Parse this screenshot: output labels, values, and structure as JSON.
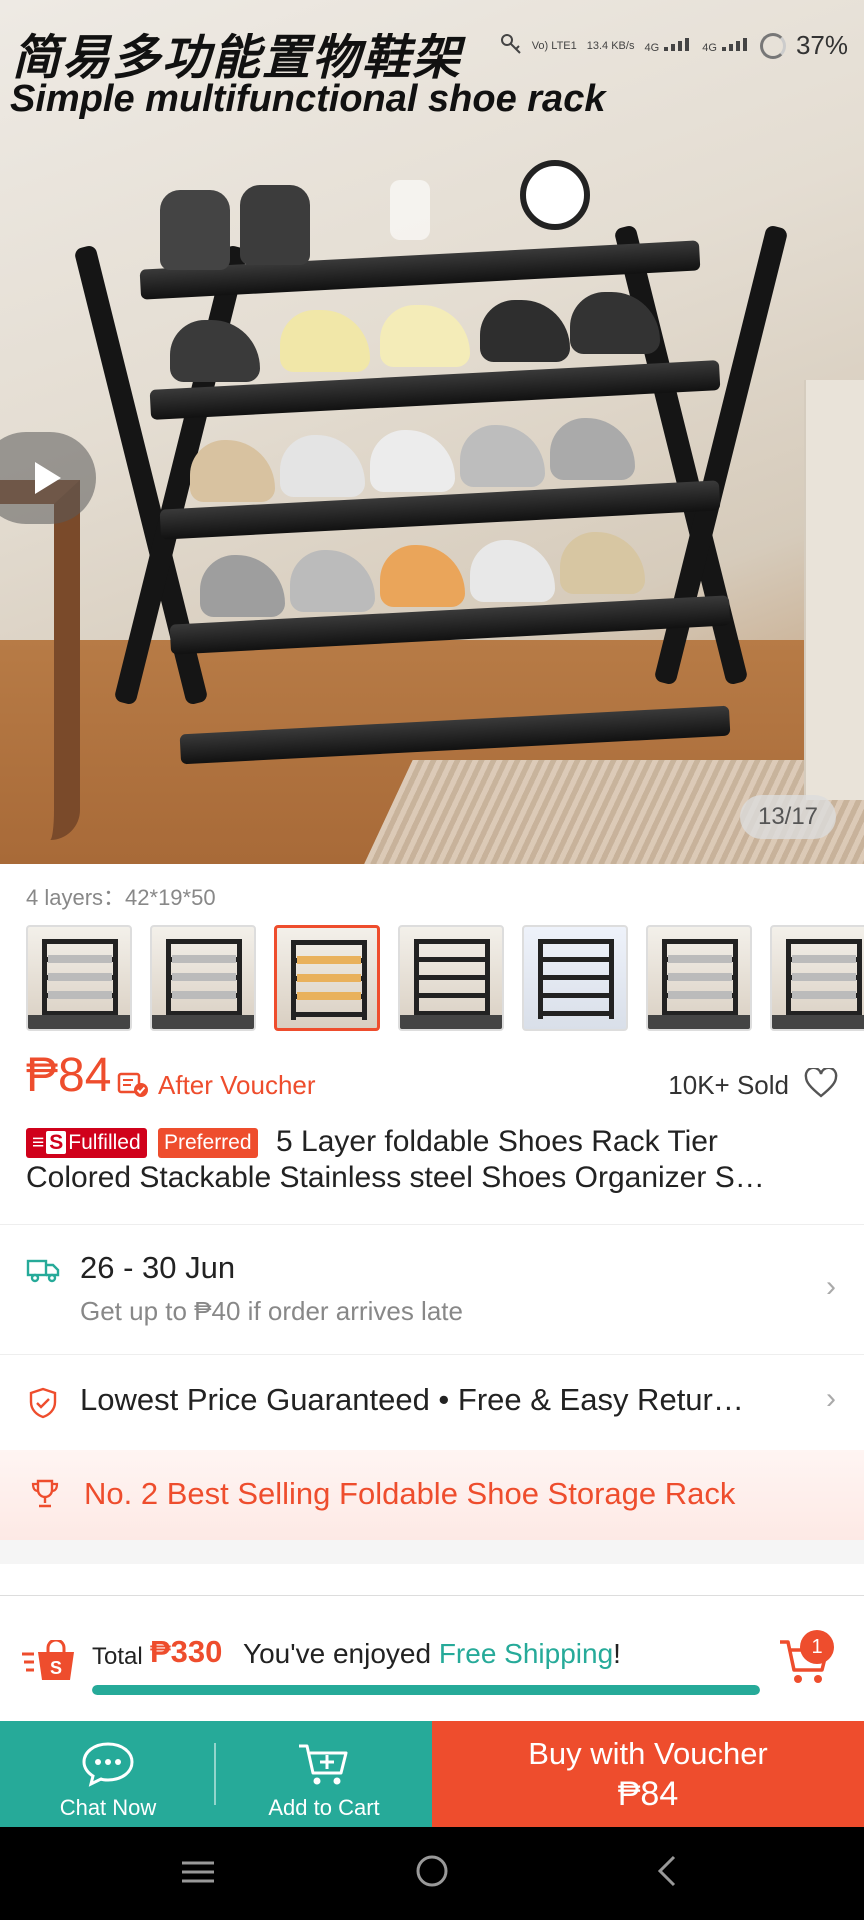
{
  "hero": {
    "title_cn": "简易多功能置物鞋架",
    "title_en": "Simple multifunctional shoe rack",
    "image_counter": "13/17"
  },
  "statusbar": {
    "volte": "Vo) LTE1",
    "speed": "13.4 KB/s",
    "net1": "4G",
    "net2": "4G",
    "battery": "37%"
  },
  "variant": {
    "label": "4 layers：42*19*50",
    "thumbnails": [
      {
        "name": "variant-1",
        "selected": false
      },
      {
        "name": "variant-2",
        "selected": false
      },
      {
        "name": "variant-3",
        "selected": true
      },
      {
        "name": "variant-4",
        "selected": false
      },
      {
        "name": "variant-5",
        "selected": false
      },
      {
        "name": "variant-6",
        "selected": false
      },
      {
        "name": "variant-7",
        "selected": false
      }
    ]
  },
  "price": {
    "value": "₱84",
    "after_voucher": "After Voucher",
    "sold": "10K+ Sold"
  },
  "product": {
    "badge_fulfilled": "Fulfilled",
    "badge_preferred": "Preferred",
    "title_line1": "5 Layer foldable Shoes Rack Tier",
    "title_line2": "Colored Stackable Stainless steel Shoes Organizer S…"
  },
  "delivery": {
    "date": "26 - 30 Jun",
    "note": "Get up to ₱40 if order arrives late"
  },
  "guarantee": {
    "text": "Lowest Price Guaranteed  •  Free & Easy Retur…"
  },
  "bestseller": {
    "text": "No. 2 Best Selling Foldable Shoe Storage Rack"
  },
  "cartbar": {
    "total_label": "Total",
    "total_value": "₱330",
    "enjoy_prefix": "You've enjoyed ",
    "enjoy_highlight": "Free Shipping",
    "enjoy_suffix": "!",
    "cart_count": "1",
    "progress": 1.0
  },
  "actions": {
    "chat": "Chat Now",
    "add_to_cart": "Add to Cart",
    "buy": "Buy with Voucher",
    "buy_price": "₱84"
  },
  "colors": {
    "brand": "#ee4d2d",
    "green": "#26aa99"
  }
}
